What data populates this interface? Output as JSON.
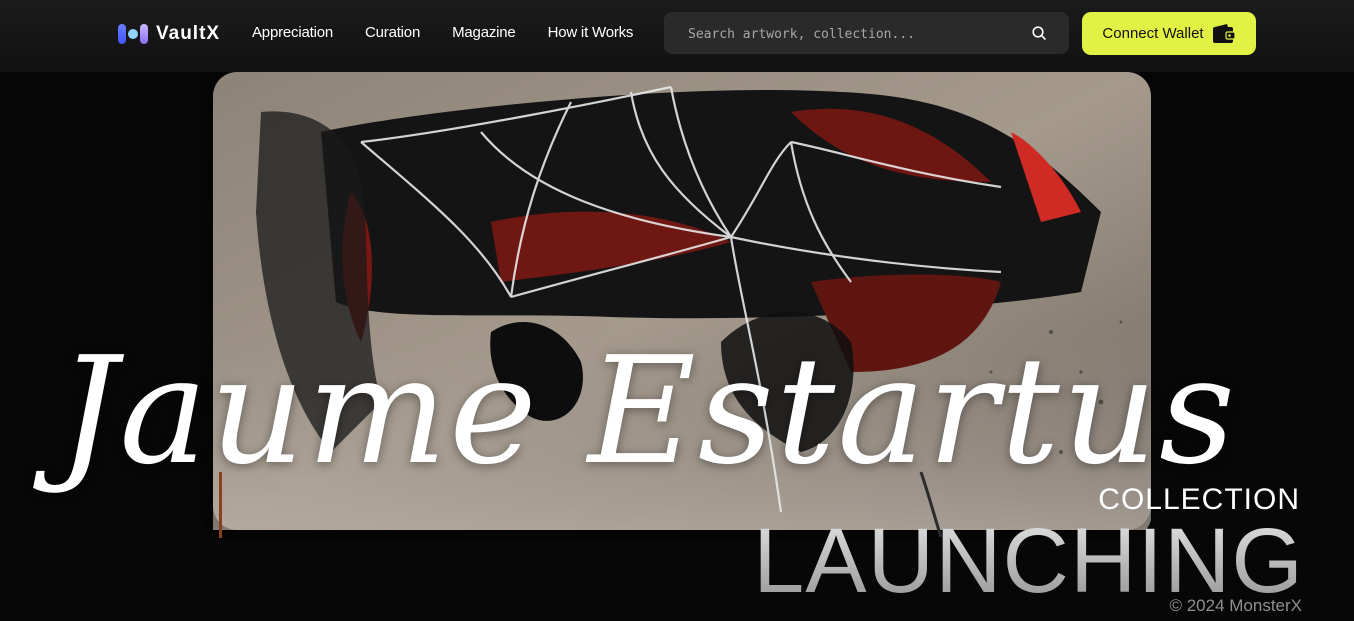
{
  "brand": {
    "name": "VaultX"
  },
  "nav": {
    "items": [
      {
        "label": "Appreciation"
      },
      {
        "label": "Curation"
      },
      {
        "label": "Magazine"
      },
      {
        "label": "How it Works"
      }
    ]
  },
  "search": {
    "placeholder": "Search artwork, collection...",
    "icon": "search-icon"
  },
  "wallet": {
    "label": "Connect Wallet",
    "icon": "wallet-icon"
  },
  "hero": {
    "title": "Jaume Estartus",
    "subtitle": "COLLECTION",
    "headline": "LAUNCHING",
    "copyright": "© 2024 MonsterX"
  },
  "colors": {
    "accent": "#e2f244",
    "background": "#070707",
    "topbar": "#141414"
  }
}
